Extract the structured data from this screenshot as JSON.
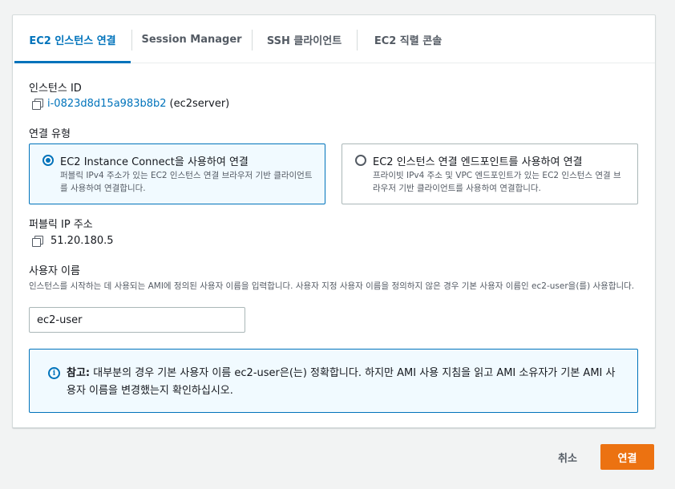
{
  "tabs": [
    {
      "label": "EC2 인스턴스 연결",
      "active": true
    },
    {
      "label": "Session Manager",
      "active": false
    },
    {
      "label": "SSH 클라이언트",
      "active": false
    },
    {
      "label": "EC2 직렬 콘솔",
      "active": false
    }
  ],
  "instance": {
    "label": "인스턴스 ID",
    "id": "i-0823d8d15a983b8b2",
    "name": "(ec2server)"
  },
  "connection_type": {
    "label": "연결 유형",
    "options": [
      {
        "title": "EC2 Instance Connect을 사용하여 연결",
        "description": "퍼블릭 IPv4 주소가 있는 EC2 인스턴스 연결 브라우저 기반 클라이언트를 사용하여 연결합니다.",
        "selected": true
      },
      {
        "title": "EC2 인스턴스 연결 엔드포인트를 사용하여 연결",
        "description": "프라이빗 IPv4 주소 및 VPC 엔드포인트가 있는 EC2 인스턴스 연결 브라우저 기반 클라이언트를 사용하여 연결합니다.",
        "selected": false
      }
    ]
  },
  "public_ip": {
    "label": "퍼블릭 IP 주소",
    "value": "51.20.180.5"
  },
  "username": {
    "label": "사용자 이름",
    "hint": "인스턴스를 시작하는 데 사용되는 AMI에 정의된 사용자 이름을 입력합니다. 사용자 지정 사용자 이름을 정의하지 않은 경우 기본 사용자 이름인 ec2-user을(를) 사용합니다.",
    "value": "ec2-user"
  },
  "alert": {
    "icon": "i",
    "bold": "참고:",
    "text": " 대부분의 경우 기본 사용자 이름 ec2-user은(는) 정확합니다. 하지만 AMI 사용 지침을 읽고 AMI 소유자가 기본 AMI 사용자 이름을 변경했는지 확인하십시오."
  },
  "footer": {
    "cancel": "취소",
    "connect": "연결"
  },
  "colors": {
    "accent": "#0073bb",
    "primary_button": "#ec7211"
  }
}
